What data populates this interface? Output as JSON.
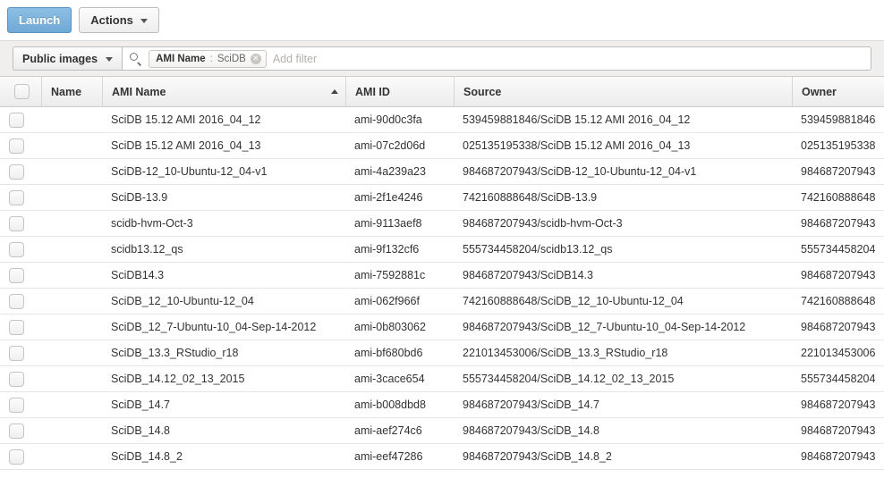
{
  "toolbar": {
    "launch_label": "Launch",
    "actions_label": "Actions"
  },
  "filter_bar": {
    "scope_label": "Public images",
    "search_icon": "search-icon",
    "filter_tag": {
      "key": "AMI Name",
      "separator": ":",
      "value": "SciDB",
      "remove_icon": "✕"
    },
    "add_filter_placeholder": "Add filter",
    "add_filter_value": ""
  },
  "table": {
    "sort_column": "AMI Name",
    "sort_direction": "ascending",
    "columns": [
      {
        "key": "select",
        "label": ""
      },
      {
        "key": "name",
        "label": "Name"
      },
      {
        "key": "ami_name",
        "label": "AMI Name"
      },
      {
        "key": "ami_id",
        "label": "AMI ID"
      },
      {
        "key": "source",
        "label": "Source"
      },
      {
        "key": "owner",
        "label": "Owner"
      }
    ],
    "rows": [
      {
        "name": "",
        "ami_name": "SciDB 15.12 AMI 2016_04_12",
        "ami_id": "ami-90d0c3fa",
        "source": "539459881846/SciDB 15.12 AMI 2016_04_12",
        "owner": "539459881846"
      },
      {
        "name": "",
        "ami_name": "SciDB 15.12 AMI 2016_04_13",
        "ami_id": "ami-07c2d06d",
        "source": "025135195338/SciDB 15.12 AMI 2016_04_13",
        "owner": "025135195338"
      },
      {
        "name": "",
        "ami_name": "SciDB-12_10-Ubuntu-12_04-v1",
        "ami_id": "ami-4a239a23",
        "source": "984687207943/SciDB-12_10-Ubuntu-12_04-v1",
        "owner": "984687207943"
      },
      {
        "name": "",
        "ami_name": "SciDB-13.9",
        "ami_id": "ami-2f1e4246",
        "source": "742160888648/SciDB-13.9",
        "owner": "742160888648"
      },
      {
        "name": "",
        "ami_name": "scidb-hvm-Oct-3",
        "ami_id": "ami-9113aef8",
        "source": "984687207943/scidb-hvm-Oct-3",
        "owner": "984687207943"
      },
      {
        "name": "",
        "ami_name": "scidb13.12_qs",
        "ami_id": "ami-9f132cf6",
        "source": "555734458204/scidb13.12_qs",
        "owner": "555734458204"
      },
      {
        "name": "",
        "ami_name": "SciDB14.3",
        "ami_id": "ami-7592881c",
        "source": "984687207943/SciDB14.3",
        "owner": "984687207943"
      },
      {
        "name": "",
        "ami_name": "SciDB_12_10-Ubuntu-12_04",
        "ami_id": "ami-062f966f",
        "source": "742160888648/SciDB_12_10-Ubuntu-12_04",
        "owner": "742160888648"
      },
      {
        "name": "",
        "ami_name": "SciDB_12_7-Ubuntu-10_04-Sep-14-2012",
        "ami_id": "ami-0b803062",
        "source": "984687207943/SciDB_12_7-Ubuntu-10_04-Sep-14-2012",
        "owner": "984687207943"
      },
      {
        "name": "",
        "ami_name": "SciDB_13.3_RStudio_r18",
        "ami_id": "ami-bf680bd6",
        "source": "221013453006/SciDB_13.3_RStudio_r18",
        "owner": "221013453006"
      },
      {
        "name": "",
        "ami_name": "SciDB_14.12_02_13_2015",
        "ami_id": "ami-3cace654",
        "source": "555734458204/SciDB_14.12_02_13_2015",
        "owner": "555734458204"
      },
      {
        "name": "",
        "ami_name": "SciDB_14.7",
        "ami_id": "ami-b008dbd8",
        "source": "984687207943/SciDB_14.7",
        "owner": "984687207943"
      },
      {
        "name": "",
        "ami_name": "SciDB_14.8",
        "ami_id": "ami-aef274c6",
        "source": "984687207943/SciDB_14.8",
        "owner": "984687207943"
      },
      {
        "name": "",
        "ami_name": "SciDB_14.8_2",
        "ami_id": "ami-eef47286",
        "source": "984687207943/SciDB_14.8_2",
        "owner": "984687207943"
      }
    ]
  },
  "colors": {
    "launch_blue": "#6fa9d6",
    "filter_bar_bg": "#f0efed",
    "header_bg": "#ececec",
    "row_border": "#e6e6e6",
    "text": "#333333"
  }
}
